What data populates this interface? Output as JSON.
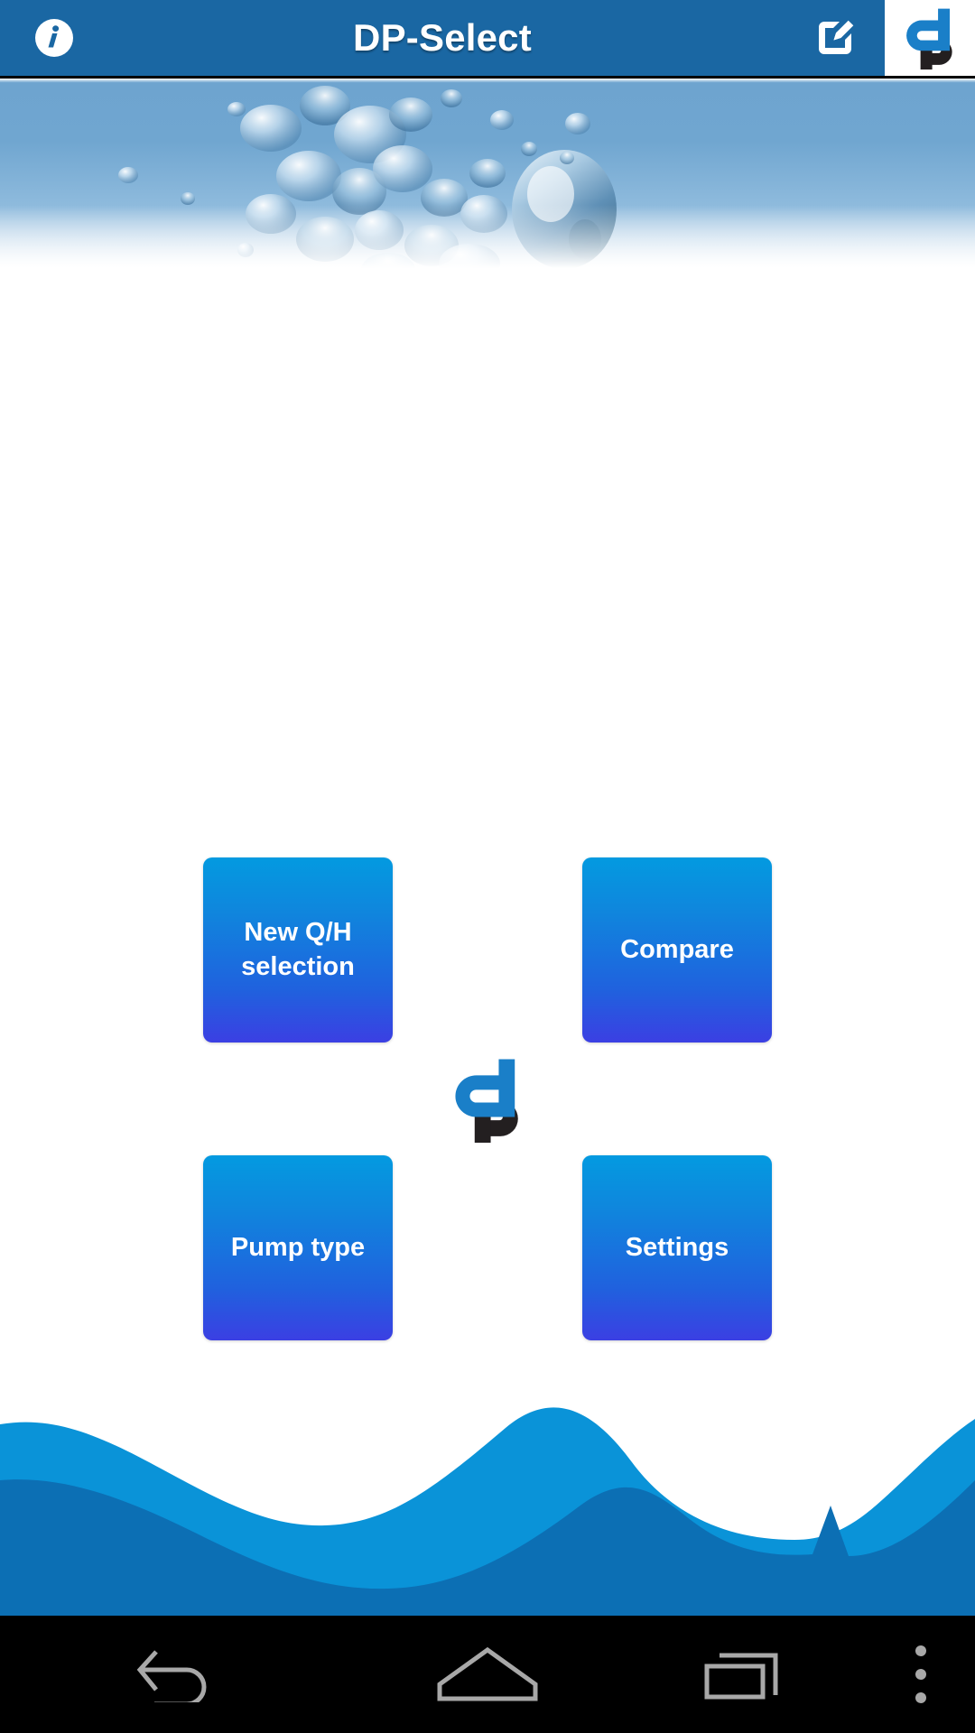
{
  "app": {
    "title": "DP-Select",
    "brand_logo_alt": "dp",
    "colors": {
      "header_bg": "#1a67a3",
      "tile_gradient_top": "#039ae0",
      "tile_gradient_bottom": "#3b3fe3",
      "wave_back": "#0a93d8",
      "wave_front": "#0c6fb4",
      "logo_blue": "#1a7fc8",
      "logo_dark": "#231f20",
      "navbar_bg": "#000000",
      "nav_icon": "#a8a8a8",
      "tile_text": "#ffffff"
    }
  },
  "header": {
    "info_label": "i",
    "title": "DP-Select",
    "icons": {
      "info": "info-icon",
      "edit": "edit-icon",
      "logo": "dp-logo-icon"
    }
  },
  "hero": {
    "image_alt": "water bubbles"
  },
  "main": {
    "tiles": [
      {
        "id": "new-qh-selection",
        "label": "New Q/H\nselection"
      },
      {
        "id": "compare",
        "label": "Compare"
      },
      {
        "id": "pump-type",
        "label": "Pump type"
      },
      {
        "id": "settings",
        "label": "Settings"
      }
    ],
    "center_logo_alt": "dp"
  },
  "navbar": {
    "buttons": [
      {
        "id": "back",
        "icon": "back-arrow-icon"
      },
      {
        "id": "home",
        "icon": "home-icon"
      },
      {
        "id": "recents",
        "icon": "recents-icon"
      },
      {
        "id": "overflow",
        "icon": "more-vertical-icon"
      }
    ]
  }
}
